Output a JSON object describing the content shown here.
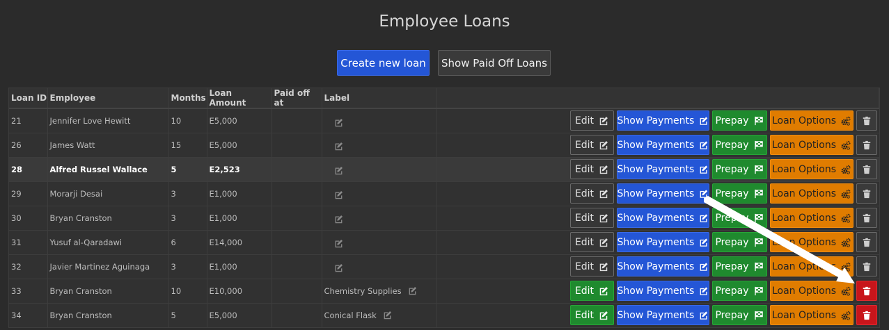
{
  "page": {
    "title": "Employee Loans",
    "create_label": "Create new loan",
    "paid_label": "Show Paid Off Loans"
  },
  "table": {
    "headers": [
      "Loan ID",
      "Employee",
      "Months",
      "Loan Amount",
      "Paid off at",
      "Label",
      ""
    ],
    "rows": [
      {
        "id": "21",
        "employee": "Jennifer Love Hewitt",
        "months": "10",
        "amount": "E5,000",
        "paid": "",
        "label": ""
      },
      {
        "id": "26",
        "employee": "James Watt",
        "months": "15",
        "amount": "E5,000",
        "paid": "",
        "label": ""
      },
      {
        "id": "28",
        "employee": "Alfred Russel Wallace",
        "months": "5",
        "amount": "E2,523",
        "paid": "",
        "label": ""
      },
      {
        "id": "29",
        "employee": "Morarji Desai",
        "months": "3",
        "amount": "E1,000",
        "paid": "",
        "label": ""
      },
      {
        "id": "30",
        "employee": "Bryan Cranston",
        "months": "3",
        "amount": "E1,000",
        "paid": "",
        "label": ""
      },
      {
        "id": "31",
        "employee": "Yusuf al-Qaradawi",
        "months": "6",
        "amount": "E14,000",
        "paid": "",
        "label": ""
      },
      {
        "id": "32",
        "employee": "Javier Martinez Aguinaga",
        "months": "3",
        "amount": "E1,000",
        "paid": "",
        "label": ""
      },
      {
        "id": "33",
        "employee": "Bryan Cranston",
        "months": "10",
        "amount": "E10,000",
        "paid": "",
        "label": "Chemistry Supplies"
      },
      {
        "id": "34",
        "employee": "Bryan Cranston",
        "months": "5",
        "amount": "E5,000",
        "paid": "",
        "label": "Conical Flask"
      }
    ],
    "highlighted_row": 2,
    "active_rows": [
      7,
      8
    ]
  },
  "actions": {
    "edit": "Edit",
    "show_payments": "Show Payments",
    "prepay": "Prepay",
    "loan_options": "Loan Options"
  },
  "colors": {
    "blue": "#2456d6",
    "green": "#1f8a2e",
    "orange": "#e07c00",
    "red": "#c8151b",
    "background": "#2b2b2b"
  }
}
